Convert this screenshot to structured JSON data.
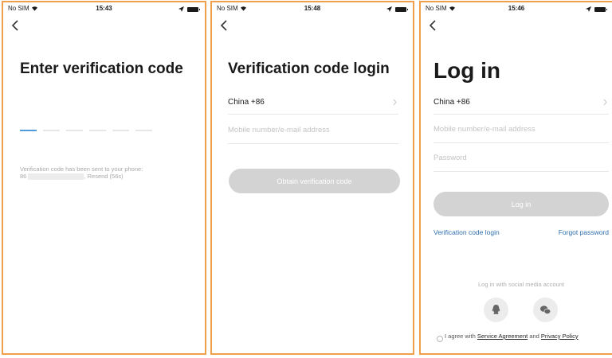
{
  "status_bar": {
    "carrier": "No SIM",
    "times": [
      "15:43",
      "15:48",
      "15:46"
    ]
  },
  "screen1": {
    "title": "Enter verification code",
    "code_slot_count": 6,
    "active_slot": 1,
    "hint_line1": "Verification code has been sent to your phone:",
    "hint_prefix": "86",
    "hint_resend": ", Resend (56s)"
  },
  "screen2": {
    "title": "Verification code login",
    "country": "China +86",
    "mobile_placeholder": "Mobile number/e-mail address",
    "button": "Obtain verification code"
  },
  "screen3": {
    "title": "Log in",
    "country": "China +86",
    "mobile_placeholder": "Mobile number/e-mail address",
    "password_placeholder": "Password",
    "button": "Log in",
    "link_vcode": "Verification code login",
    "link_forgot": "Forgot password",
    "social_label": "Log in with social media account",
    "social_icons": [
      "qq-icon",
      "wechat-icon"
    ],
    "agree_prefix": "I agree with ",
    "service_agreement": "Service Agreement",
    "agree_and": " and ",
    "privacy_policy": "Privacy Policy"
  },
  "colors": {
    "panel_border": "#f0a04b",
    "link": "#2f6fae",
    "active_slot": "#4f9ad8",
    "disabled_button": "#d3d3d3"
  }
}
